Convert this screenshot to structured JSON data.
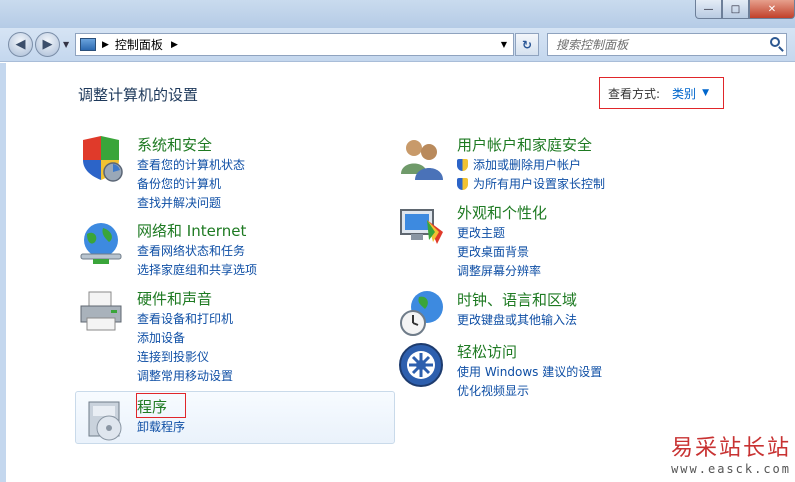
{
  "window": {
    "controls": {
      "minimize": "—",
      "maximize": "□",
      "close": "✕"
    }
  },
  "toolbar": {
    "back_icon": "back-arrow-icon",
    "forward_icon": "forward-arrow-icon",
    "address_path": "控制面板",
    "search_placeholder": "搜索控制面板"
  },
  "main": {
    "heading": "调整计算机的设置",
    "view_by_label": "查看方式:",
    "view_by_value": "类别",
    "categories_left": [
      {
        "title": "系统和安全",
        "icon": "shield-windows-icon",
        "links": [
          "查看您的计算机状态",
          "备份您的计算机",
          "查找并解决问题"
        ]
      },
      {
        "title": "网络和 Internet",
        "icon": "network-globe-icon",
        "links": [
          "查看网络状态和任务",
          "选择家庭组和共享选项"
        ]
      },
      {
        "title": "硬件和声音",
        "icon": "printer-icon",
        "links": [
          "查看设备和打印机",
          "添加设备",
          "连接到投影仪",
          "调整常用移动设置"
        ]
      },
      {
        "title": "程序",
        "icon": "programs-disc-icon",
        "links": [
          "卸载程序"
        ]
      }
    ],
    "categories_right": [
      {
        "title": "用户帐户和家庭安全",
        "icon": "users-icon",
        "links": [
          "添加或删除用户帐户",
          "为所有用户设置家长控制"
        ]
      },
      {
        "title": "外观和个性化",
        "icon": "monitor-palette-icon",
        "links": [
          "更改主题",
          "更改桌面背景",
          "调整屏幕分辨率"
        ]
      },
      {
        "title": "时钟、语言和区域",
        "icon": "clock-globe-icon",
        "links": [
          "更改键盘或其他输入法"
        ]
      },
      {
        "title": "轻松访问",
        "icon": "ease-of-access-icon",
        "links": [
          "使用 Windows 建议的设置",
          "优化视频显示"
        ]
      }
    ]
  },
  "watermark": {
    "text": "易采站长站",
    "url": "www.easck.com"
  }
}
